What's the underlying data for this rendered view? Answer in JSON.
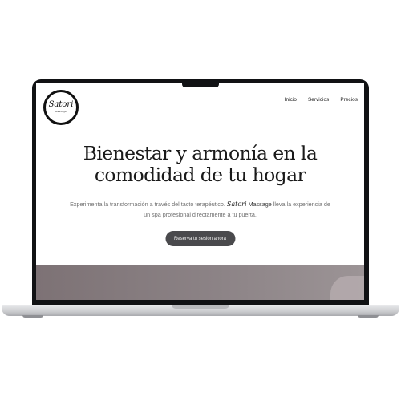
{
  "site": {
    "logo": {
      "word": "Satori",
      "sub": "Massage"
    },
    "nav": [
      {
        "label": "Inicio"
      },
      {
        "label": "Servicios"
      },
      {
        "label": "Precios"
      }
    ]
  },
  "hero": {
    "title_line1": "Bienestar y armonía en la",
    "title_line2": "comodidad de tu hogar",
    "subtitle_before": "Experimenta la transformación a través del tacto terapéutico.",
    "brand_script": "Satori",
    "brand_word": "Massage",
    "subtitle_after": "lleva la experiencia de un spa profesional directamente a tu puerta.",
    "cta_label": "Reserva tu sesión ahora"
  },
  "colors": {
    "laptop_frame": "#111214",
    "cta_background": "#4a4a4d",
    "band": "#8c8386"
  }
}
